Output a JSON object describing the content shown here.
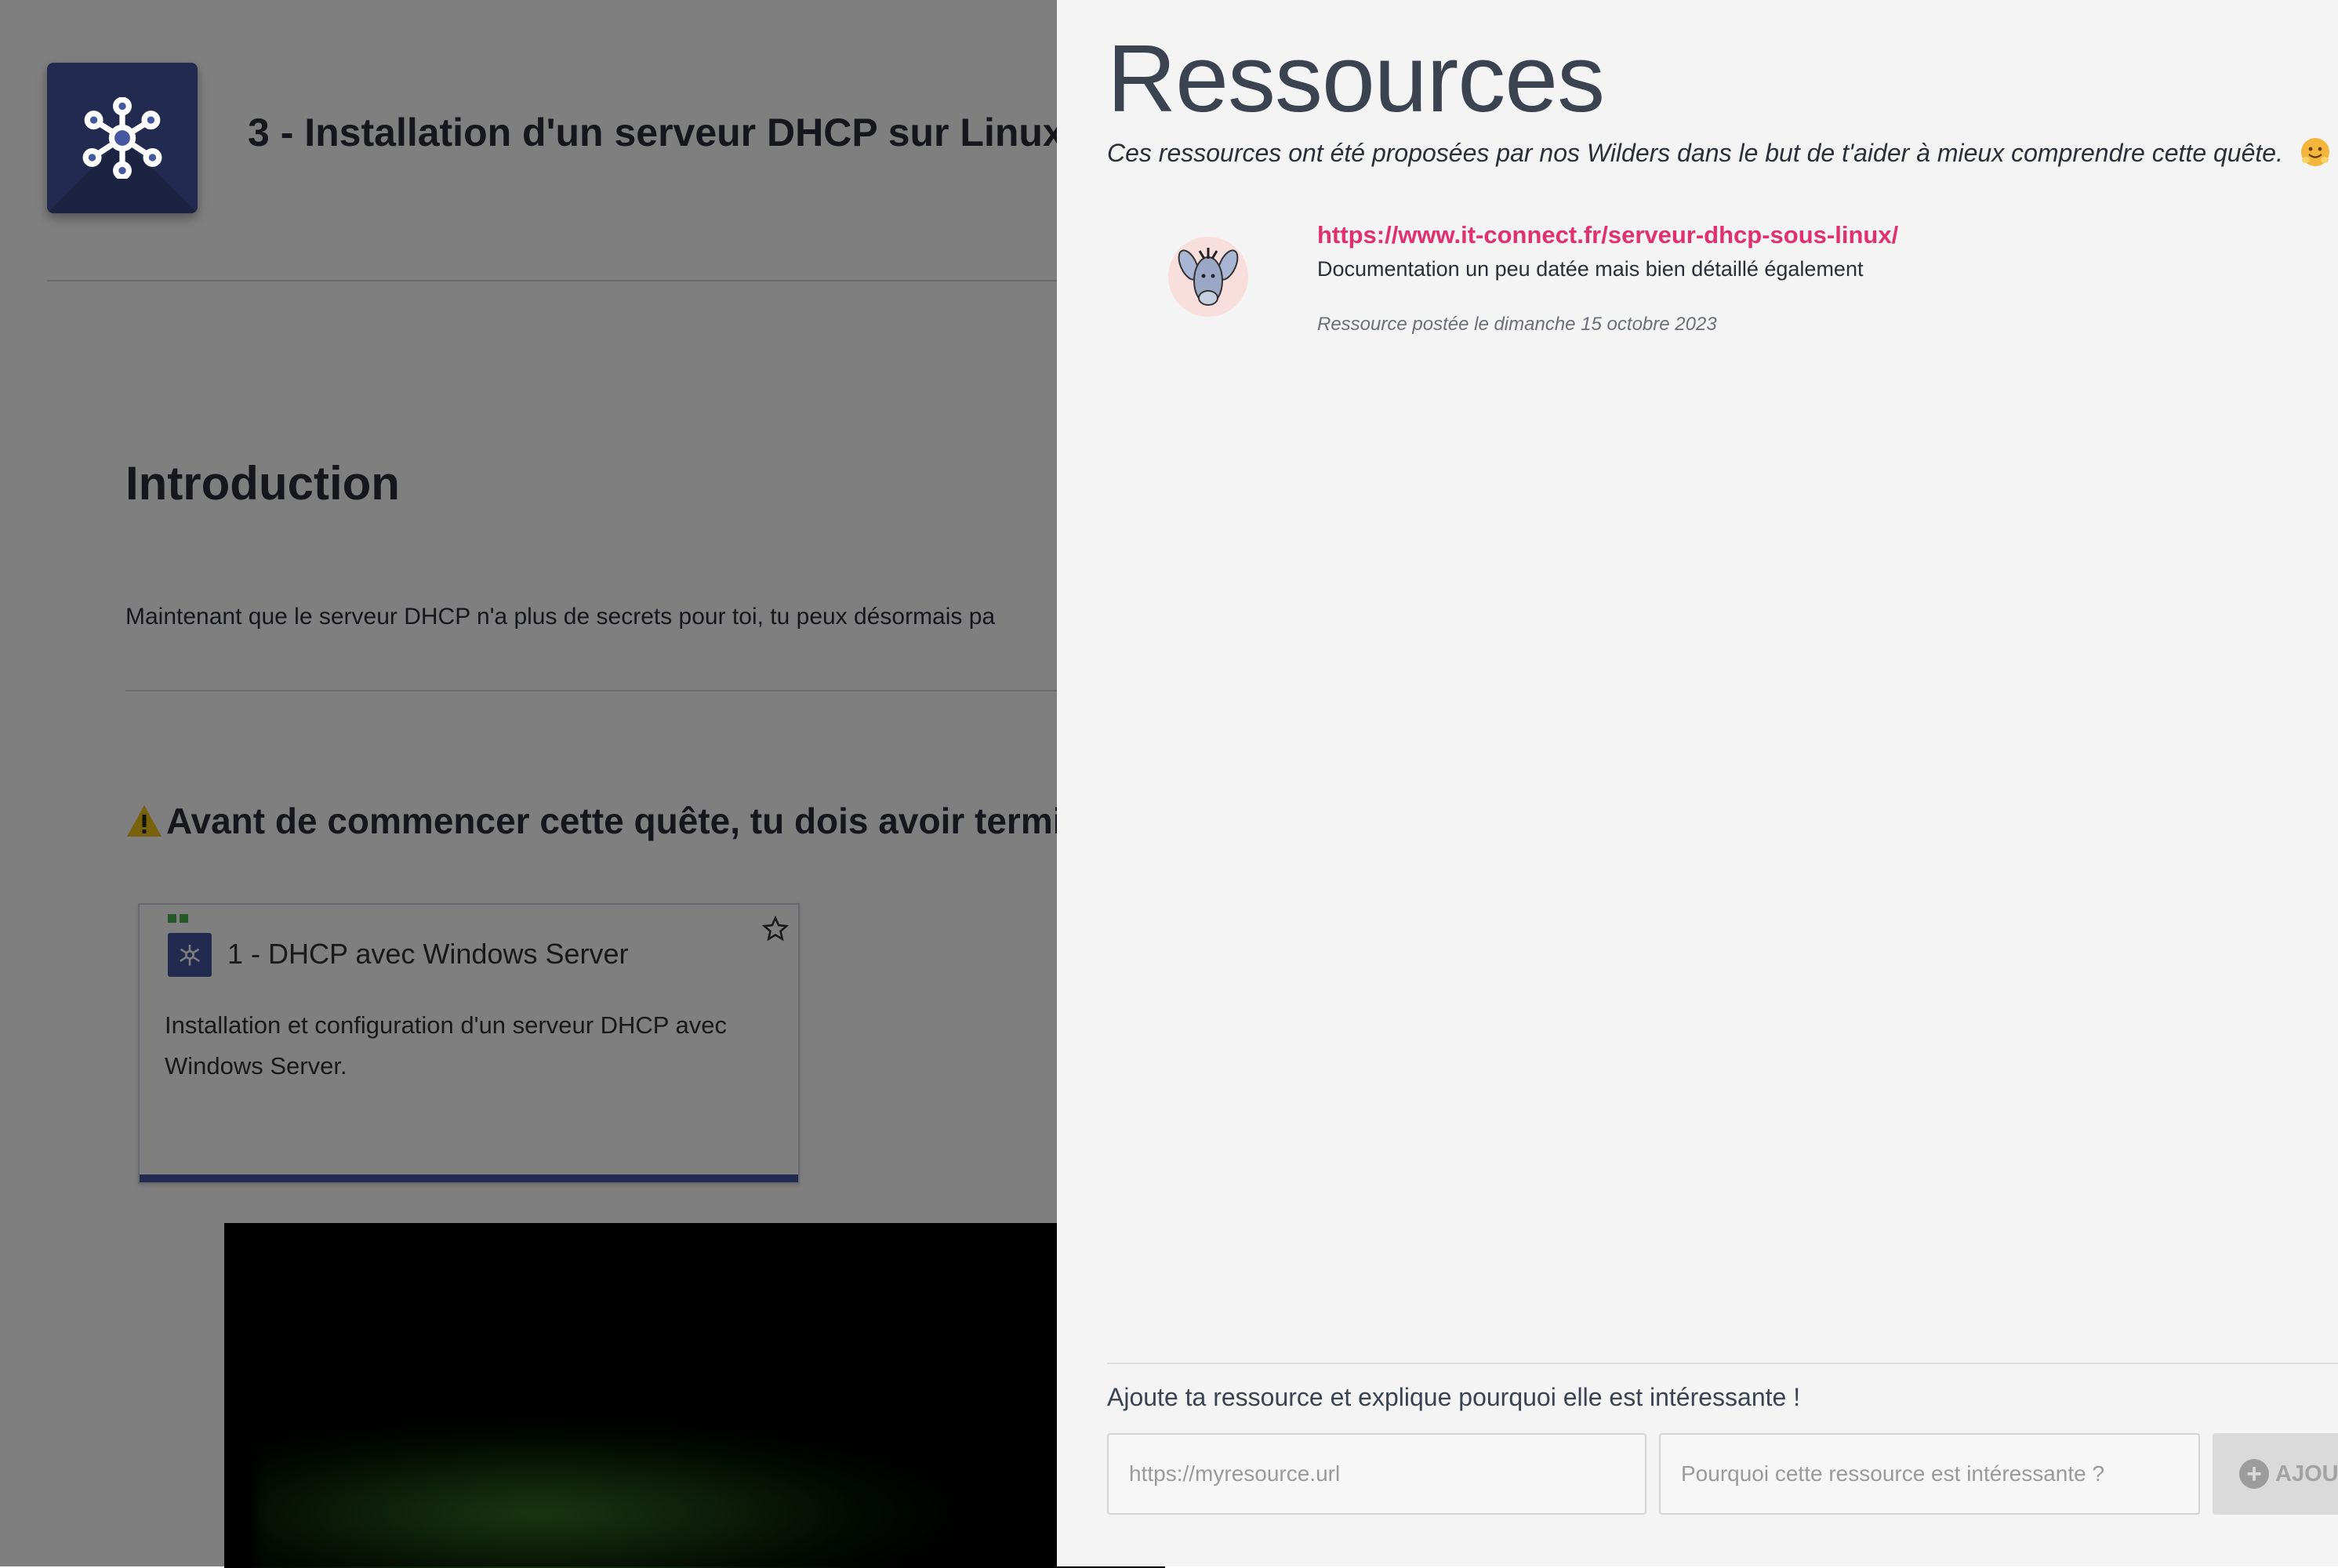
{
  "page": {
    "quest_title": "3 - Installation d'un serveur DHCP sur Linux",
    "intro_heading": "Introduction",
    "intro_text": "Maintenant que le serveur DHCP n'a plus de secrets pour toi, tu peux désormais pa",
    "prereq_heading": "Avant de commencer cette quête, tu dois avoir termi",
    "prereq_card": {
      "title": "1 - DHCP avec Windows Server",
      "description": "Installation et configuration d'un serveur DHCP avec Windows Server."
    }
  },
  "drawer": {
    "title": "Ressources",
    "subtitle": "Ces ressources ont été proposées par nos Wilders dans le but de t'aider à mieux comprendre cette quête.",
    "resources": [
      {
        "url": "https://www.it-connect.fr/serveur-dhcp-sous-linux/",
        "description": "Documentation un peu datée mais bien détaillé également",
        "date": "Ressource postée le dimanche 15 octobre 2023"
      }
    ],
    "form": {
      "label": "Ajoute ta ressource et explique pourquoi elle est intéressante !",
      "url_placeholder": "https://myresource.url",
      "why_placeholder": "Pourquoi cette ressource est intéressante ?",
      "add_label": "AJOUT"
    }
  },
  "colors": {
    "brand_blue": "#44579f",
    "link_pink": "#e0306f",
    "drawer_bg": "#f4f4f4"
  },
  "icons": [
    "network-hub-icon",
    "warning-icon",
    "star-icon",
    "hugging-face-emoji-icon",
    "plus-circle-icon"
  ]
}
